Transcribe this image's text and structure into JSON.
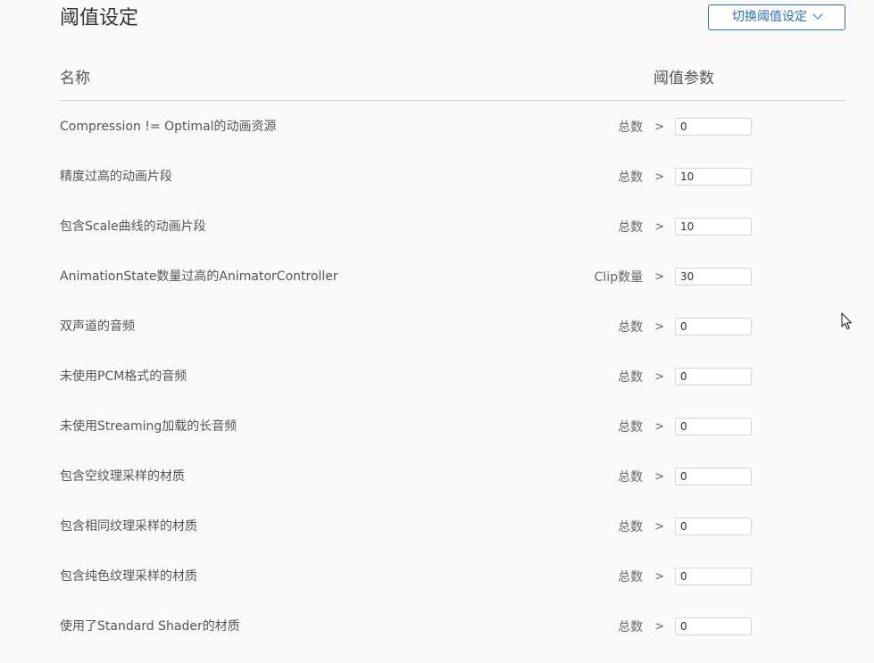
{
  "title": "阈值设定",
  "switch_button": {
    "label": "切换阈值设定",
    "icon": "chevron-down-icon"
  },
  "columns": {
    "name": "名称",
    "param": "阈值参数"
  },
  "rows": [
    {
      "name": "Compression != Optimal的动画资源",
      "label": "总数",
      "op": ">",
      "value": "0"
    },
    {
      "name": "精度过高的动画片段",
      "label": "总数",
      "op": ">",
      "value": "10"
    },
    {
      "name": "包含Scale曲线的动画片段",
      "label": "总数",
      "op": ">",
      "value": "10"
    },
    {
      "name": "AnimationState数量过高的AnimatorController",
      "label": "Clip数量",
      "op": ">",
      "value": "30"
    },
    {
      "name": "双声道的音频",
      "label": "总数",
      "op": ">",
      "value": "0"
    },
    {
      "name": "未使用PCM格式的音频",
      "label": "总数",
      "op": ">",
      "value": "0"
    },
    {
      "name": "未使用Streaming加载的长音频",
      "label": "总数",
      "op": ">",
      "value": "0"
    },
    {
      "name": "包含空纹理采样的材质",
      "label": "总数",
      "op": ">",
      "value": "0"
    },
    {
      "name": "包含相同纹理采样的材质",
      "label": "总数",
      "op": ">",
      "value": "0"
    },
    {
      "name": "包含纯色纹理采样的材质",
      "label": "总数",
      "op": ">",
      "value": "0"
    },
    {
      "name": "使用了Standard Shader的材质",
      "label": "总数",
      "op": ">",
      "value": "0"
    }
  ]
}
